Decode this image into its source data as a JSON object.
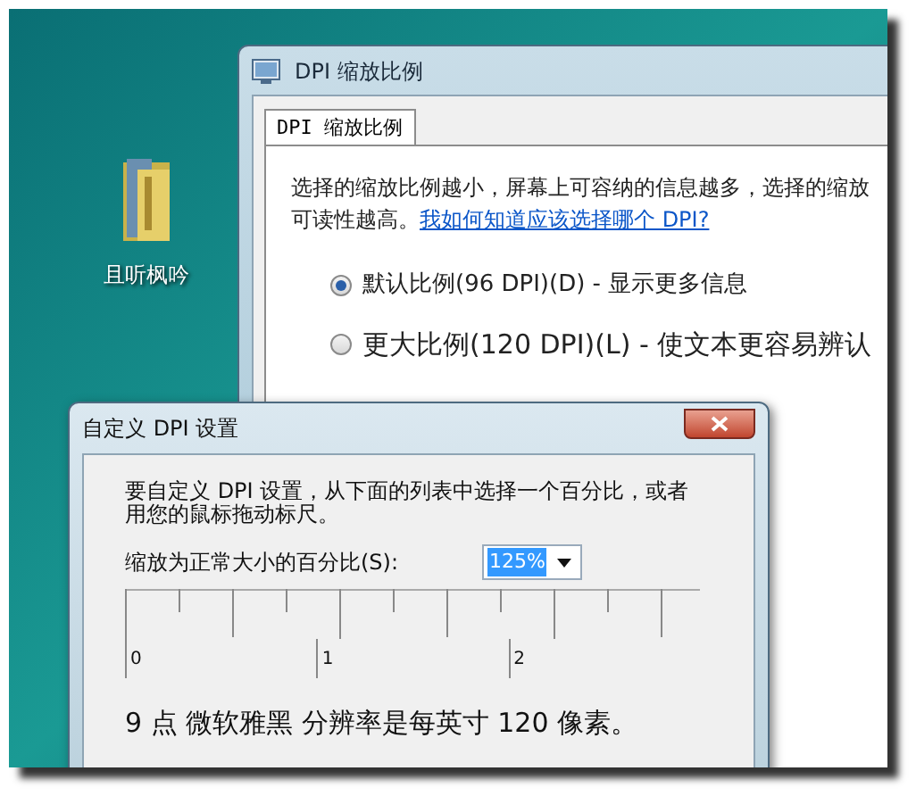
{
  "desktop": {
    "icons": [
      {
        "label": "且听枫吟"
      }
    ]
  },
  "main_window": {
    "title": "DPI 缩放比例",
    "tabs": [
      {
        "label": "DPI 缩放比例",
        "selected": true
      }
    ],
    "description": "选择的缩放比例越小，屏幕上可容纳的信息越多，选择的缩放",
    "description_line_2": "可读性越高。",
    "help_link": "我如何知道应该选择哪个 DPI?",
    "options": [
      {
        "label": "默认比例(96 DPI)(D) - 显示更多信息",
        "selected": true
      },
      {
        "label": "更大比例(120 DPI)(L) - 使文本更容易辨认",
        "selected": false
      }
    ]
  },
  "custom_dialog": {
    "title": "自定义 DPI 设置",
    "instructions": "要自定义 DPI 设置，从下面的列表中选择一个百分比，或者用您的鼠标拖动标尺。",
    "scale_label": "缩放为正常大小的百分比(S):",
    "scale_value": "125%",
    "ruler_labels": [
      "0",
      "1",
      "2"
    ],
    "sample_text": "9 点 微软雅黑 分辨率是每英寸 120 像素。"
  }
}
